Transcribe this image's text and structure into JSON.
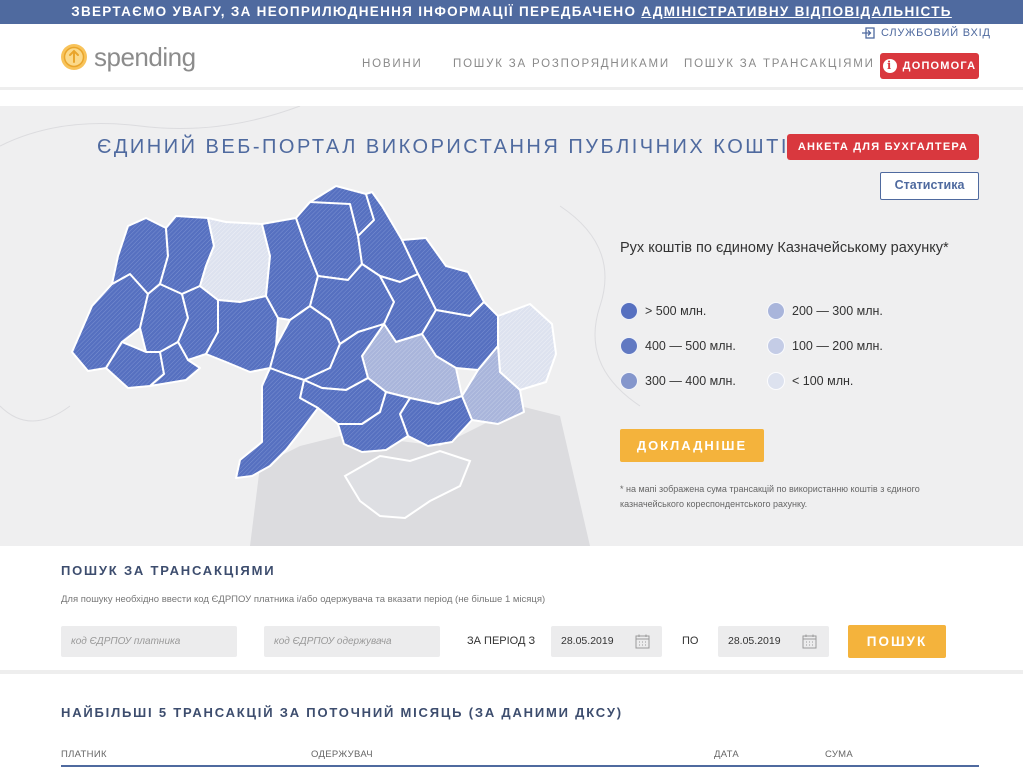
{
  "banner": {
    "text_plain": "ЗВЕРТАЄМО УВАГУ, ЗА НЕОПРИЛЮДНЕННЯ ІНФОРМАЦІЇ ПЕРЕДБАЧЕНО ",
    "text_link": "АДМІНІСТРАТИВНУ ВІДПОВІДАЛЬНІСТЬ"
  },
  "header": {
    "logo_text": "spending",
    "service_login": "СЛУЖБОВИЙ ВХІД",
    "nav": [
      "НОВИНИ",
      "ПОШУК ЗА РОЗПОРЯДНИКАМИ",
      "ПОШУК ЗА ТРАНСАКЦІЯМИ"
    ],
    "help_label": "ДОПОМОГА"
  },
  "hero": {
    "title": "ЄДИНИЙ ВЕБ-ПОРТАЛ ВИКОРИСТАННЯ ПУБЛІЧНИХ КОШТІВ",
    "anketa_label": "АНКЕТА ДЛЯ БУХГАЛТЕРА",
    "stat_label": "Статистика",
    "flow_title": "Рух коштів по єдиному Казначейському рахунку*",
    "legend": [
      {
        "label": "> 500 млн.",
        "color": "#5670c0"
      },
      {
        "label": "400 — 500 млн.",
        "color": "#6179c2"
      },
      {
        "label": "300 — 400 млн.",
        "color": "#8496cc"
      },
      {
        "label": "200 — 300 млн.",
        "color": "#a9b5db"
      },
      {
        "label": "100 — 200 млн.",
        "color": "#c4cce6"
      },
      {
        "label": "< 100 млн.",
        "color": "#dde2ef"
      }
    ],
    "more_label": "ДОКЛАДНІШЕ",
    "footnote": "* на мапі зображена сума трансакцій по використанню коштів з єдиного казначейського кореспондентського рахунку."
  },
  "search": {
    "title": "ПОШУК ЗА ТРАНСАКЦІЯМИ",
    "hint": "Для пошуку необхідно ввести код ЄДРПОУ платника і/або одержувача та вказати період (не більше 1 місяця)",
    "payer_placeholder": "код ЄДРПОУ платника",
    "receiver_placeholder": "код ЄДРПОУ одержувача",
    "period_label": "ЗА ПЕРІОД З",
    "date_from": "28.05.2019",
    "to_label": "ПО",
    "date_to": "28.05.2019",
    "search_label": "ПОШУК"
  },
  "top5": {
    "title": "НАЙБІЛЬШІ 5 ТРАНСАКЦІЙ ЗА ПОТОЧНИЙ МІСЯЦЬ (ЗА ДАНИМИ ДКСУ)",
    "columns": [
      "ПЛАТНИК",
      "ОДЕРЖУВАЧ",
      "ДАТА",
      "СУМА"
    ]
  },
  "colors": {
    "brand_blue": "#4f6a9f",
    "red": "#d9383e",
    "orange": "#f4b33c",
    "region_dark": "#5670c0",
    "region_light": "#dde2ef"
  }
}
